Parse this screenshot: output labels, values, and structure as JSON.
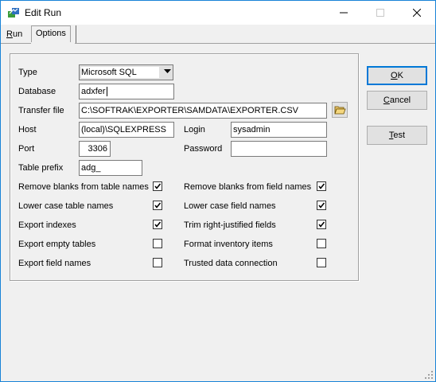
{
  "window": {
    "title": "Edit Run",
    "minimize_icon": "minimize-icon",
    "maximize_icon": "maximize-icon",
    "close_icon": "close-icon"
  },
  "tabs": [
    {
      "label": "Run",
      "accel": "R",
      "rest": "un",
      "active": false
    },
    {
      "label": "Options",
      "active": true
    }
  ],
  "form": {
    "type": {
      "label": "Type",
      "value": "Microsoft SQL"
    },
    "database": {
      "label": "Database",
      "value": "adxfer"
    },
    "transfer_file": {
      "label": "Transfer file",
      "value": "C:\\SOFTRAK\\EXPORTER\\SAMDATA\\EXPORTER.CSV",
      "browse_icon": "folder-open-icon"
    },
    "host": {
      "label": "Host",
      "value": "(local)\\SQLEXPRESS"
    },
    "login": {
      "label": "Login",
      "value": "sysadmin"
    },
    "port": {
      "label": "Port",
      "value": "3306"
    },
    "password": {
      "label": "Password",
      "value": ""
    },
    "table_prefix": {
      "label": "Table prefix",
      "value": "adg_"
    }
  },
  "options_left": [
    {
      "label": "Remove blanks from table names",
      "checked": true
    },
    {
      "label": "Lower case table names",
      "checked": true
    },
    {
      "label": "Export indexes",
      "checked": true
    },
    {
      "label": "Export empty tables",
      "checked": false
    },
    {
      "label": "Export field names",
      "checked": false
    }
  ],
  "options_right": [
    {
      "label": "Remove blanks from field names",
      "checked": true
    },
    {
      "label": "Lower case field names",
      "checked": true
    },
    {
      "label": "Trim right-justified fields",
      "checked": true
    },
    {
      "label": "Format inventory items",
      "checked": false
    },
    {
      "label": "Trusted data connection",
      "checked": false
    }
  ],
  "buttons": {
    "ok": {
      "accel": "O",
      "rest": "K"
    },
    "cancel": {
      "accel": "C",
      "rest": "ancel"
    },
    "test": {
      "accel": "T",
      "rest": "est"
    }
  }
}
